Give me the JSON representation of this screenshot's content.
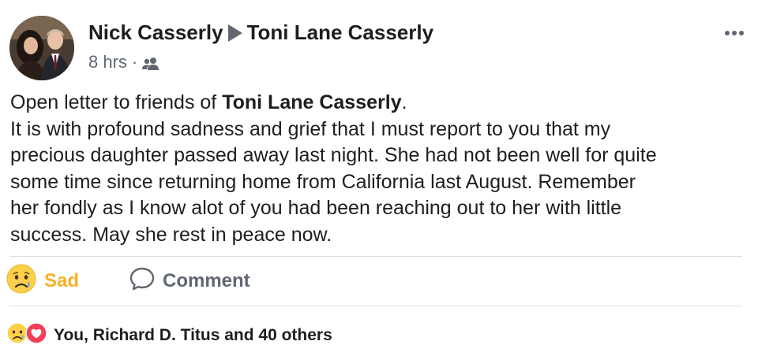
{
  "post": {
    "author": "Nick Casserly",
    "recipient": "Toni Lane Casserly",
    "timestamp": "8 hrs",
    "separator": "·",
    "audience_icon": "friends-icon",
    "body": {
      "line1_prefix": "Open letter to friends of ",
      "line1_bold": "Toni Lane Casserly",
      "line1_suffix": ".",
      "lines": [
        "It is with profound sadness and grief that I must report to you that my",
        "precious daughter passed away last night. She had not been well for quite",
        "some time since returning home from California last August. Remember",
        "her fondly as I know alot of you had been reaching out to her with little",
        "success. May she rest in peace now."
      ]
    }
  },
  "actions": {
    "reaction_label": "Sad",
    "reaction_icon": "sad-emoji-icon",
    "comment_label": "Comment",
    "comment_icon": "comment-bubble-icon"
  },
  "reactions_summary": {
    "text": "You, Richard D. Titus and 40 others",
    "icons": [
      "sad-emoji-icon",
      "love-heart-icon"
    ]
  },
  "colors": {
    "sad_accent": "#f7b125",
    "text": "#1c1e21",
    "muted": "#606770",
    "love_red": "#f33e58"
  }
}
